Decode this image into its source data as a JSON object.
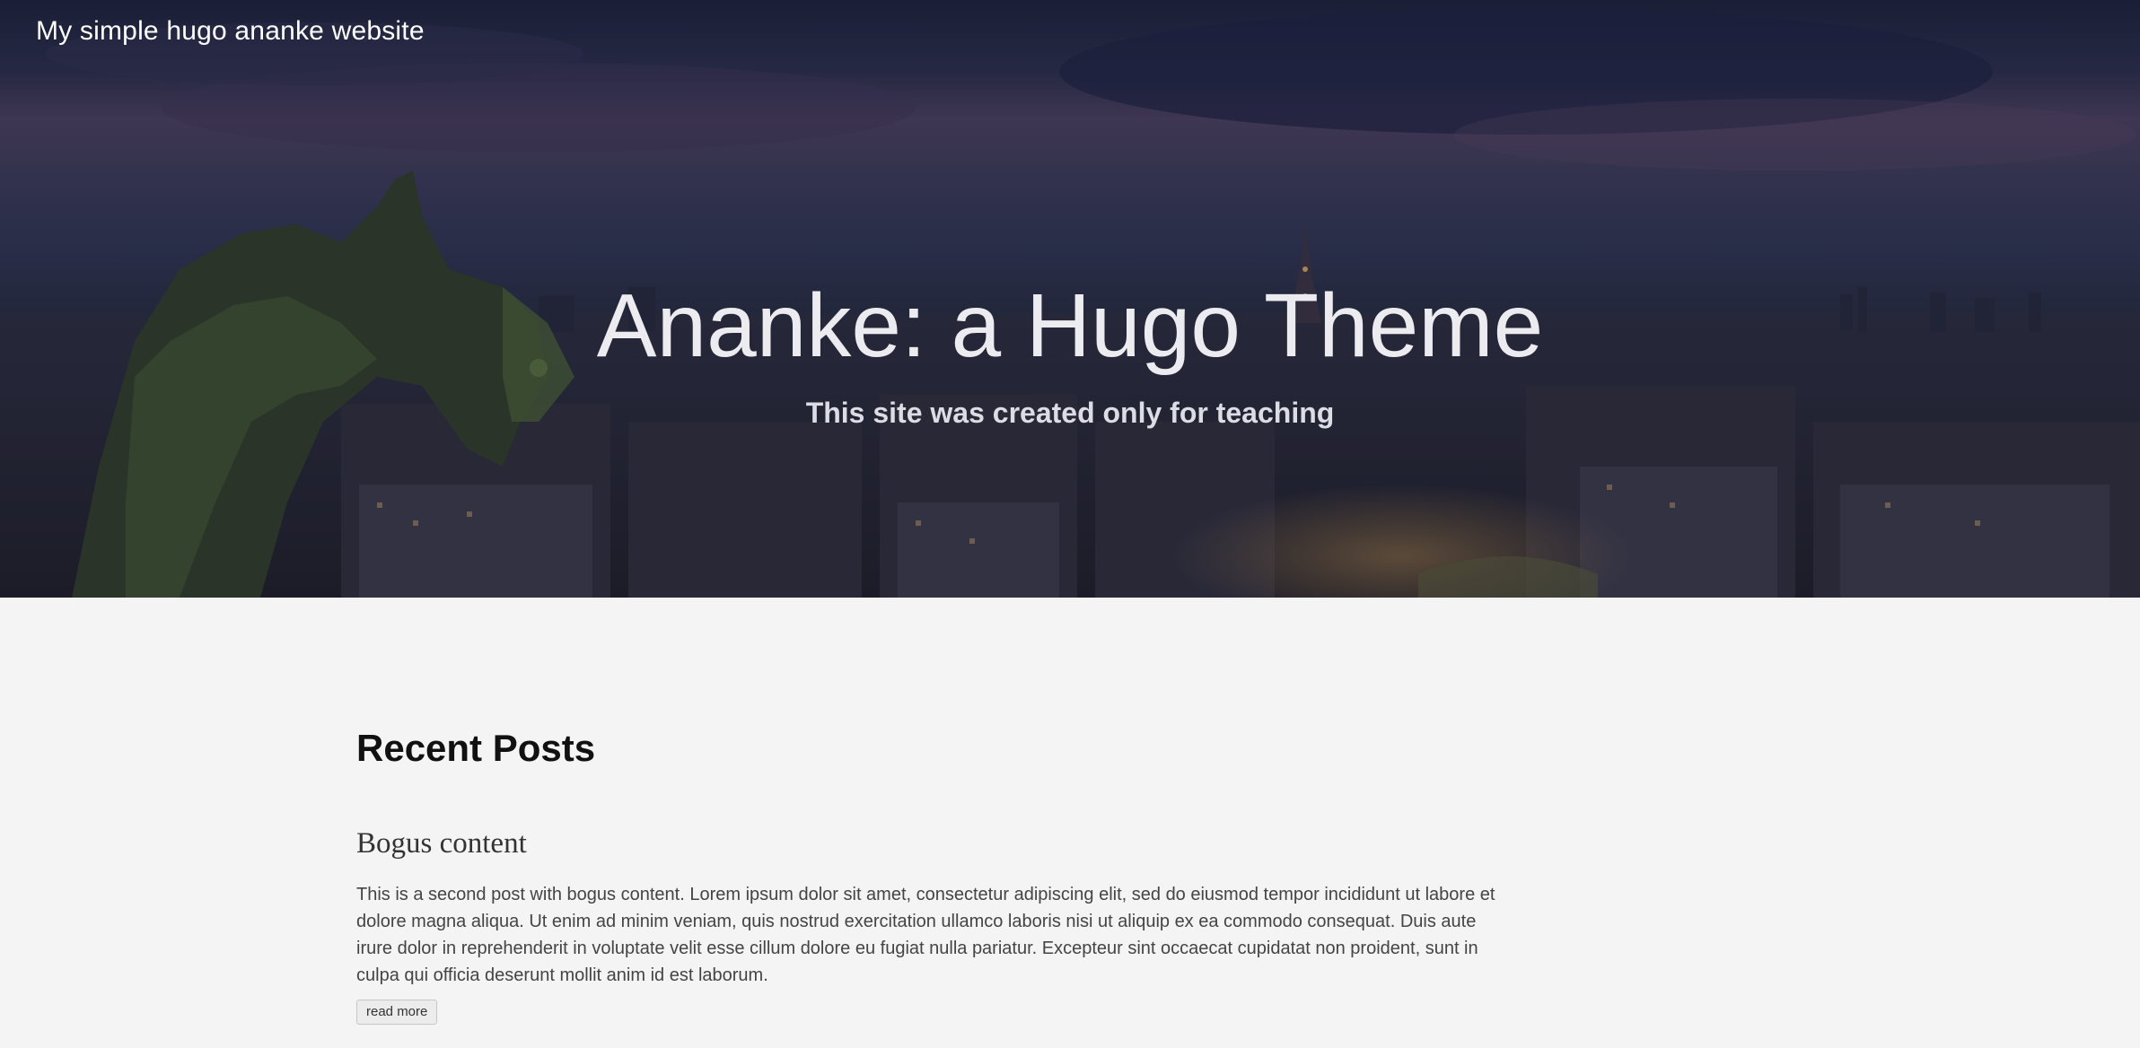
{
  "site": {
    "title": "My simple hugo ananke website"
  },
  "hero": {
    "title": "Ananke: a Hugo Theme",
    "subtitle": "This site was created only for teaching",
    "background_image": "paris-skyline-with-gargoyle"
  },
  "main": {
    "section_title": "Recent Posts",
    "posts": [
      {
        "title": "Bogus content",
        "summary": "This is a second post with bogus content. Lorem ipsum dolor sit amet, consectetur adipiscing elit, sed do eiusmod tempor incididunt ut labore et dolore magna aliqua. Ut enim ad minim veniam, quis nostrud exercitation ullamco laboris nisi ut aliquip ex ea commodo consequat. Duis aute irure dolor in reprehenderit in voluptate velit esse cillum dolore eu fugiat nulla pariatur. Excepteur sint occaecat cupidatat non proident, sunt in culpa qui officia deserunt mollit anim id est laborum.",
        "read_more_label": "read more"
      }
    ]
  },
  "colors": {
    "page_background": "#f4f4f4",
    "hero_overlay": "#252a3e",
    "heading_text": "#111111",
    "body_text": "#444444"
  }
}
